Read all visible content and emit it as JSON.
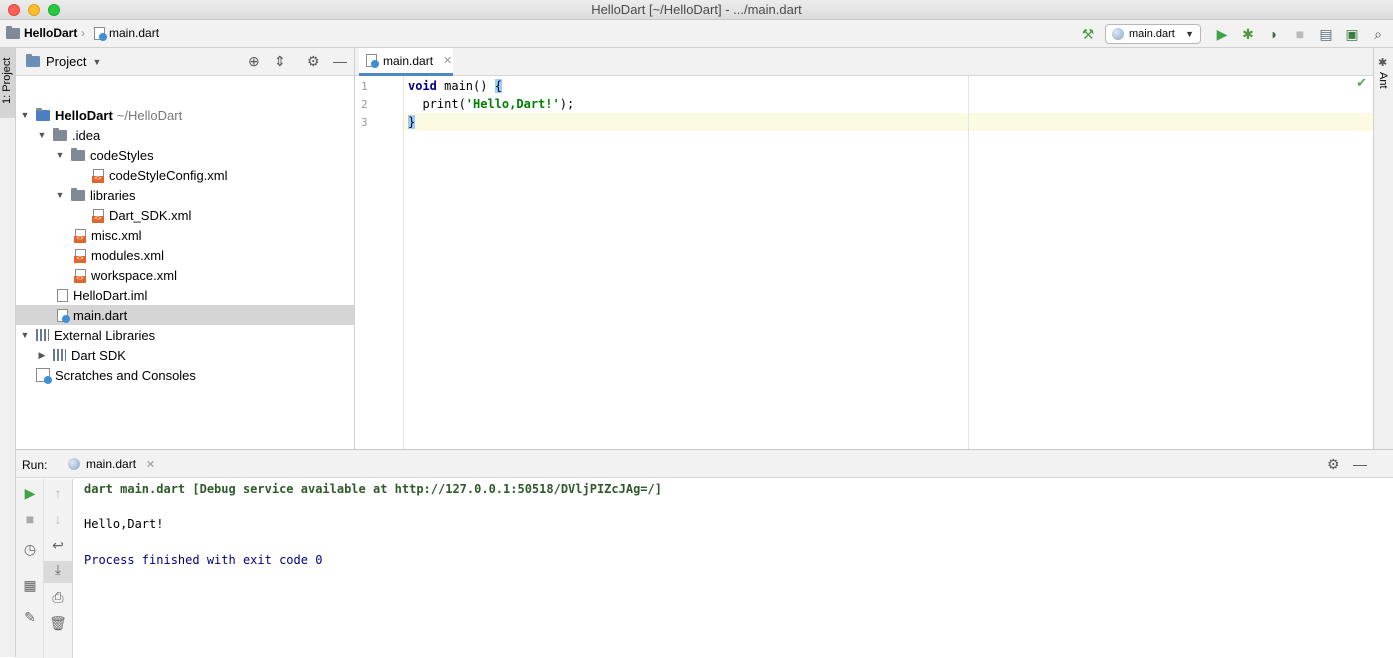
{
  "window": {
    "title": "HelloDart [~/HelloDart] - .../main.dart"
  },
  "navbar": {
    "project_crumb": "HelloDart",
    "file_crumb": "main.dart",
    "run_config": "main.dart"
  },
  "project_panel": {
    "title": "Project",
    "tree": [
      {
        "label": "HelloDart",
        "suffix": "~/HelloDart"
      },
      {
        "label": ".idea"
      },
      {
        "label": "codeStyles"
      },
      {
        "label": "codeStyleConfig.xml"
      },
      {
        "label": "libraries"
      },
      {
        "label": "Dart_SDK.xml"
      },
      {
        "label": "misc.xml"
      },
      {
        "label": "modules.xml"
      },
      {
        "label": "workspace.xml"
      },
      {
        "label": "HelloDart.iml"
      },
      {
        "label": "main.dart"
      },
      {
        "label": "External Libraries"
      },
      {
        "label": "Dart SDK"
      },
      {
        "label": "Scratches and Consoles"
      }
    ]
  },
  "left_stripe": {
    "project_label": "1: Project"
  },
  "right_stripe": {
    "ant_label": "Ant"
  },
  "editor": {
    "tab_label": "main.dart",
    "line_numbers": [
      "1",
      "2",
      "3"
    ],
    "code": {
      "l1_kw": "void",
      "l1_rest": " main() ",
      "l1_brace": "{",
      "l2_pre": "  print(",
      "l2_str": "'Hello,Dart!'",
      "l2_post": ");",
      "l3_brace": "}"
    }
  },
  "run_panel": {
    "label": "Run:",
    "tab_label": "main.dart",
    "console": {
      "command": "dart main.dart [Debug service available at http://127.0.0.1:50518/DVljPIZcJAg=/]",
      "output": "Hello,Dart!",
      "exit": "Process finished with exit code 0"
    }
  },
  "colors": {
    "accent": "#4a88c7",
    "run_green": "#59a869",
    "keyword": "#000080",
    "string": "#008000"
  }
}
